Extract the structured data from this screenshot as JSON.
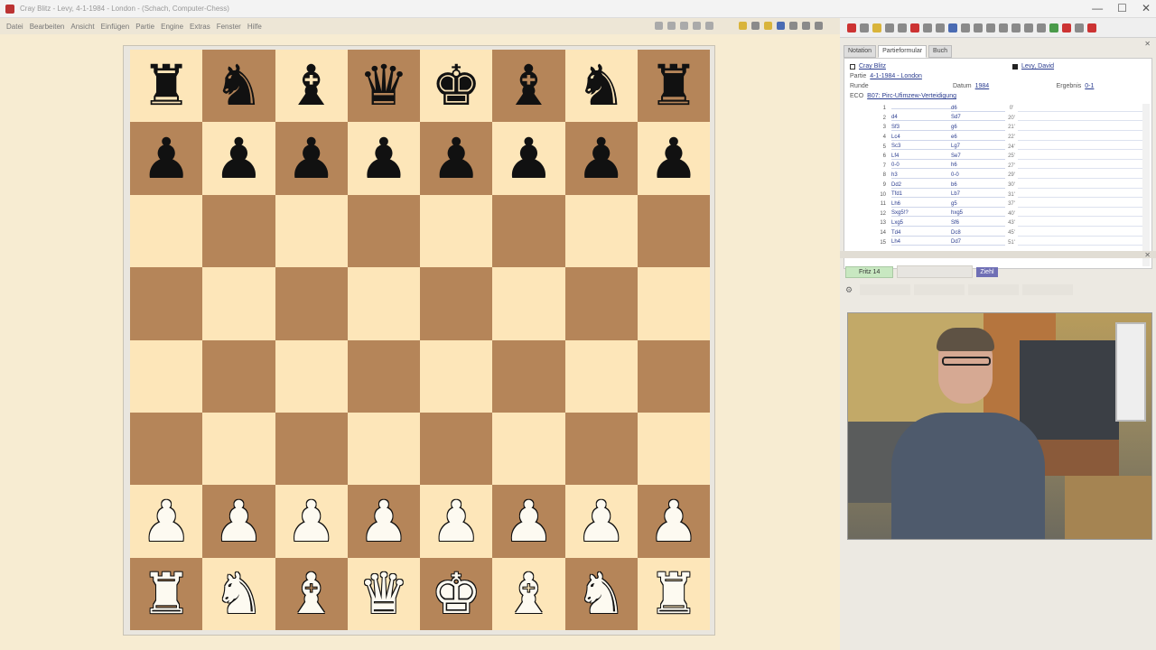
{
  "window": {
    "title": "Cray Blitz - Levy, 4-1-1984 - London - (Schach, Computer-Chess)",
    "controls": [
      "—",
      "☐",
      "✕"
    ]
  },
  "menu": [
    "Datei",
    "Bearbeiten",
    "Ansicht",
    "Einfügen",
    "Partie",
    "Engine",
    "Extras",
    "Fenster",
    "Hilfe"
  ],
  "board": {
    "ranks": [
      [
        "br",
        "bn",
        "bb",
        "bq",
        "bk",
        "bb",
        "bn",
        "br"
      ],
      [
        "bp",
        "bp",
        "bp",
        "bp",
        "bp",
        "bp",
        "bp",
        "bp"
      ],
      [
        "",
        "",
        "",
        "",
        "",
        "",
        "",
        ""
      ],
      [
        "",
        "",
        "",
        "",
        "",
        "",
        "",
        ""
      ],
      [
        "",
        "",
        "",
        "",
        "",
        "",
        "",
        ""
      ],
      [
        "",
        "",
        "",
        "",
        "",
        "",
        "",
        ""
      ],
      [
        "wp",
        "wp",
        "wp",
        "wp",
        "wp",
        "wp",
        "wp",
        "wp"
      ],
      [
        "wr",
        "wn",
        "wb",
        "wq",
        "wk",
        "wb",
        "wn",
        "wr"
      ]
    ],
    "light_color": "#fde6b9",
    "dark_color": "#b58559"
  },
  "panel": {
    "tabs": [
      "Notation",
      "Partieformular",
      "Buch"
    ],
    "active_tab": 1,
    "close": "✕",
    "white_player": "Cray Blitz",
    "black_player": "Levy, David",
    "partie_label": "Partie",
    "partie_val": "4-1-1984 - London",
    "runde_label": "Runde",
    "datum_label": "Datum",
    "datum_val": "1984",
    "ergebnis_label": "Ergebnis",
    "ergebnis_val": "0-1",
    "eco_label": "ECO",
    "eco_val": "B07: Pirc-Ufimzew-Verteidigung"
  },
  "moves": [
    {
      "n": "1",
      "w": "",
      "b": "d6",
      "t": "0'"
    },
    {
      "n": "2",
      "w": "d4",
      "b": "Sd7",
      "t": "20'"
    },
    {
      "n": "3",
      "w": "Sf3",
      "b": "g6",
      "t": "21'"
    },
    {
      "n": "4",
      "w": "Lc4",
      "b": "e6",
      "t": "22'"
    },
    {
      "n": "5",
      "w": "Sc3",
      "b": "Lg7",
      "t": "24'"
    },
    {
      "n": "6",
      "w": "Lf4",
      "b": "Se7",
      "t": "25'"
    },
    {
      "n": "7",
      "w": "0-0",
      "b": "h6",
      "t": "27'"
    },
    {
      "n": "8",
      "w": "h3",
      "b": "0-0",
      "t": "29'"
    },
    {
      "n": "9",
      "w": "Dd2",
      "b": "b6",
      "t": "30'"
    },
    {
      "n": "10",
      "w": "Tfd1",
      "b": "Lb7",
      "t": "31'"
    },
    {
      "n": "11",
      "w": "Lh6",
      "b": "g5",
      "t": "37'"
    },
    {
      "n": "12",
      "w": "Sxg5!?",
      "b": "hxg5",
      "t": "40'"
    },
    {
      "n": "13",
      "w": "Lxg5",
      "b": "Sf6",
      "t": "43'"
    },
    {
      "n": "14",
      "w": "Td4",
      "b": "Dc8",
      "t": "45'"
    },
    {
      "n": "15",
      "w": "Lh4",
      "b": "Dd7",
      "t": "51'"
    }
  ],
  "engine": {
    "name": "Fritz 14",
    "button": "Ziehl",
    "gear": "⚙"
  }
}
